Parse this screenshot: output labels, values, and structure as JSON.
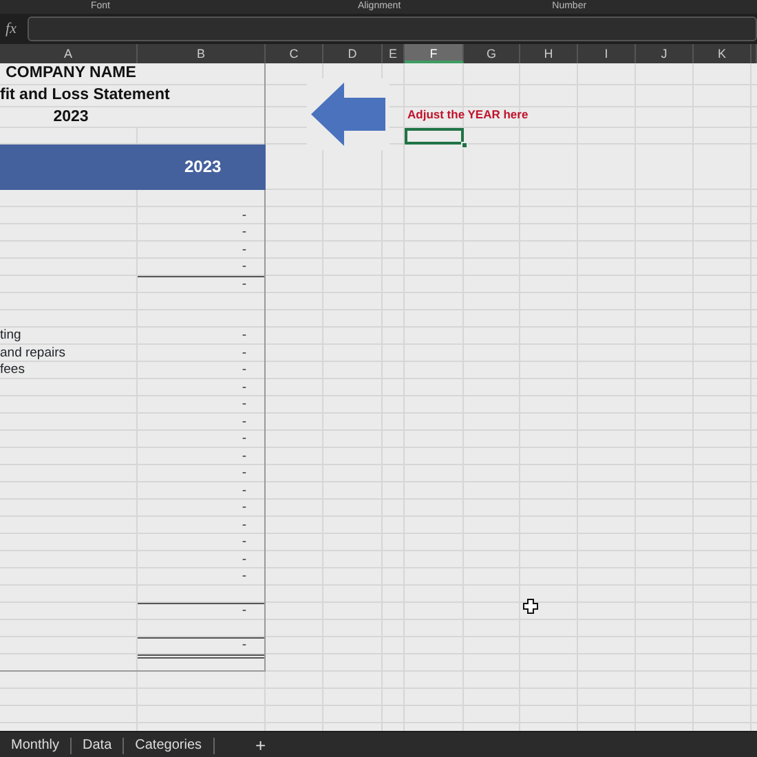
{
  "ribbon_groups": [
    "Font",
    "Alignment",
    "Number"
  ],
  "formula_bar": {
    "function_label": "fx"
  },
  "columns": [
    {
      "label": "A",
      "selected": false
    },
    {
      "label": "B",
      "selected": false
    },
    {
      "label": "C",
      "selected": false
    },
    {
      "label": "D",
      "selected": false
    },
    {
      "label": "E",
      "selected": false
    },
    {
      "label": "F",
      "selected": true
    },
    {
      "label": "G",
      "selected": false
    },
    {
      "label": "H",
      "selected": false
    },
    {
      "label": "I",
      "selected": false
    },
    {
      "label": "J",
      "selected": false
    },
    {
      "label": "K",
      "selected": false
    }
  ],
  "rows": [
    {
      "kind": "title",
      "text": "COMPANY NAME",
      "selected": false
    },
    {
      "kind": "title",
      "text": "fit and Loss Statement",
      "selected": false
    },
    {
      "kind": "title",
      "text": "2023",
      "selected": false
    },
    {
      "kind": "blank",
      "selected": true
    },
    {
      "kind": "header",
      "value": "2023",
      "selected": false
    },
    {
      "kind": "blank",
      "selected": false
    },
    {
      "kind": "item",
      "value": "-",
      "selected": false
    },
    {
      "kind": "item",
      "value": "-",
      "selected": false
    },
    {
      "kind": "item",
      "value": "-",
      "selected": false
    },
    {
      "kind": "item",
      "value": "-",
      "selected": false
    },
    {
      "kind": "total",
      "value": "-",
      "selected": false
    },
    {
      "kind": "blank",
      "selected": false
    },
    {
      "kind": "blank",
      "selected": false
    },
    {
      "kind": "item",
      "label": "ting",
      "value": "-",
      "selected": false
    },
    {
      "kind": "item",
      "label": "and repairs",
      "value": "-",
      "selected": false
    },
    {
      "kind": "item",
      "label": "fees",
      "value": "-",
      "selected": false
    },
    {
      "kind": "item",
      "value": "-",
      "selected": false
    },
    {
      "kind": "item",
      "value": "-",
      "selected": false
    },
    {
      "kind": "item",
      "value": "-",
      "selected": false
    },
    {
      "kind": "item",
      "value": "-",
      "selected": false
    },
    {
      "kind": "item",
      "value": "-",
      "selected": false
    },
    {
      "kind": "item",
      "value": "-",
      "selected": false
    },
    {
      "kind": "item",
      "value": "-",
      "selected": false
    },
    {
      "kind": "item",
      "value": "-",
      "selected": false
    },
    {
      "kind": "item",
      "value": "-",
      "selected": false
    },
    {
      "kind": "item",
      "value": "-",
      "selected": false
    },
    {
      "kind": "item",
      "value": "-",
      "selected": false
    },
    {
      "kind": "item",
      "value": "-",
      "selected": false
    },
    {
      "kind": "blank",
      "selected": false
    },
    {
      "kind": "total",
      "value": "-",
      "selected": false
    },
    {
      "kind": "blank",
      "selected": false
    },
    {
      "kind": "total",
      "value": "-",
      "selected": false
    },
    {
      "kind": "end",
      "selected": false
    }
  ],
  "annotation": {
    "text": "Adjust the YEAR here"
  },
  "sheet_tabs": [
    {
      "label": "Monthly",
      "selected": false
    },
    {
      "label": "Data",
      "selected": false
    },
    {
      "label": "Categories",
      "selected": false
    }
  ],
  "add_sheet": "+"
}
